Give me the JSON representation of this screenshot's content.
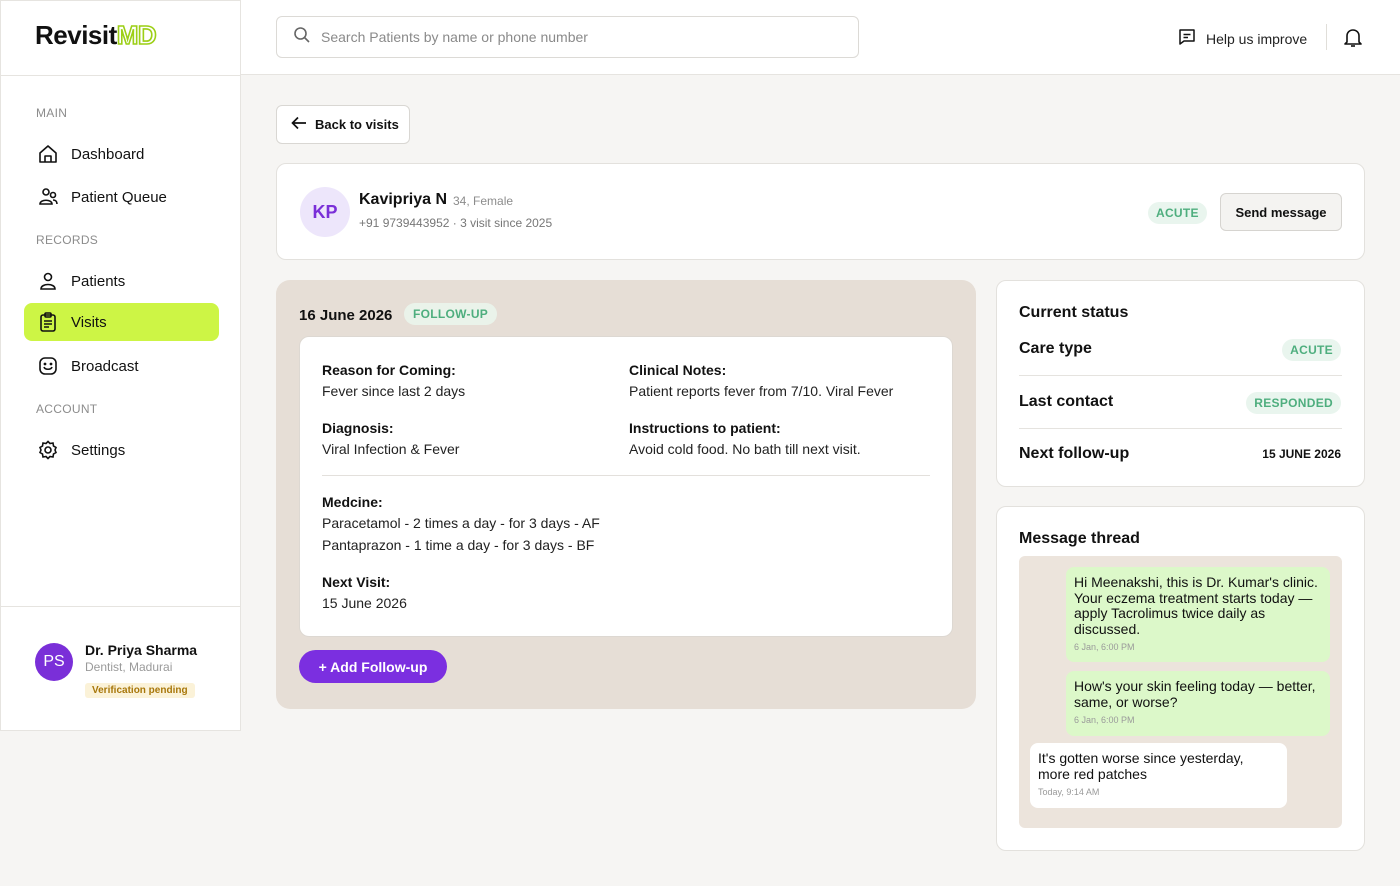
{
  "brand": {
    "part1": "Revisit",
    "part2": "MD"
  },
  "search": {
    "placeholder": "Search Patients by name or phone number"
  },
  "header": {
    "help_label": "Help us improve"
  },
  "sidebar": {
    "sections": {
      "main": "MAIN",
      "records": "RECORDS",
      "account": "ACCOUNT"
    },
    "items": [
      {
        "label": "Dashboard",
        "icon": "home-icon"
      },
      {
        "label": "Patient Queue",
        "icon": "users-icon"
      },
      {
        "label": "Patients",
        "icon": "user-icon"
      },
      {
        "label": "Visits",
        "icon": "clipboard-icon",
        "active": true
      },
      {
        "label": "Broadcast",
        "icon": "smile-icon"
      },
      {
        "label": "Settings",
        "icon": "gear-icon"
      }
    ],
    "profile": {
      "initials": "PS",
      "name": "Dr. Priya Sharma",
      "role": "Dentist, Madurai",
      "status": "Verification pending"
    }
  },
  "back_label": "Back to visits",
  "patient": {
    "initials": "KP",
    "name": "Kavipriya N",
    "meta": "34, Female",
    "contact": "+91 9739443952 · 3 visit since 2025",
    "care_badge": "ACUTE",
    "send_label": "Send message"
  },
  "visit": {
    "date": "16 June 2026",
    "type_badge": "FOLLOW-UP",
    "reason_label": "Reason for Coming:",
    "reason": "Fever since last 2 days",
    "notes_label": "Clinical Notes:",
    "notes": "Patient reports fever from 7/10. Viral Fever",
    "diagnosis_label": "Diagnosis:",
    "diagnosis": "Viral Infection & Fever",
    "instructions_label": "Instructions to patient:",
    "instructions": "Avoid cold food. No bath till next visit.",
    "medicine_label": "Medcine:",
    "medicines": [
      "Paracetamol - 2 times a day - for 3 days - AF",
      "Pantaprazon - 1 time a day - for 3 days - BF"
    ],
    "next_label": "Next Visit:",
    "next": "15 June 2026",
    "add_label": "+ Add Follow-up"
  },
  "status": {
    "title": "Current status",
    "care_label": "Care type",
    "care_value": "ACUTE",
    "contact_label": "Last contact",
    "contact_value": "RESPONDED",
    "followup_label": "Next follow-up",
    "followup_value": "15 JUNE 2026"
  },
  "thread": {
    "title": "Message thread",
    "messages": [
      {
        "dir": "out",
        "text": "Hi Meenakshi, this is Dr. Kumar's clinic. Your eczema treatment starts today — apply Tacrolimus twice daily as discussed.",
        "time": "6 Jan, 6:00 PM"
      },
      {
        "dir": "out",
        "text": "How's your skin feeling today — better, same, or worse?",
        "time": "6 Jan, 6:00 PM"
      },
      {
        "dir": "in",
        "text": "It's gotten worse since yesterday, more red patches",
        "time": "Today, 9:14 AM"
      }
    ]
  },
  "colors": {
    "accent_lime": "#cdf545",
    "purple": "#7b2fe0",
    "green_badge": "#4eae7e"
  }
}
